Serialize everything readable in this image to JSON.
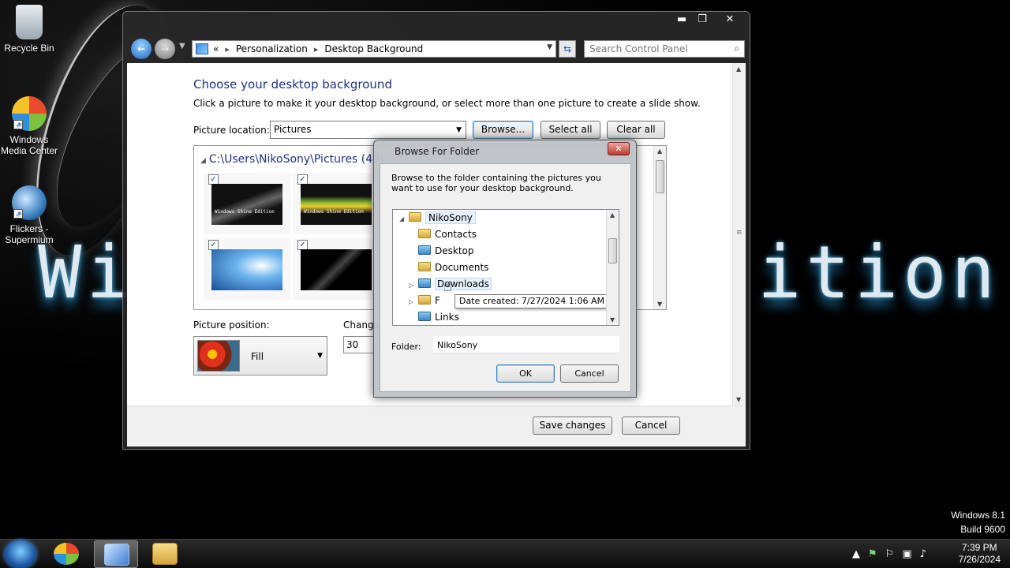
{
  "desktop": {
    "icons": [
      {
        "label": "Recycle Bin",
        "icon": "recycle-bin-icon"
      },
      {
        "label": "Windows Media Center",
        "icon": "media-center-icon"
      },
      {
        "label": "Flickers - Supermium",
        "icon": "supermium-icon"
      }
    ],
    "wallpaper_left": "Wi",
    "wallpaper_right": "ition",
    "os_name": "Windows 8.1",
    "os_build": "Build 9600"
  },
  "taskbar": {
    "items": [
      "start-orb-icon",
      "windows-media-center-taskbar-icon",
      "control-panel-taskbar-icon",
      "file-explorer-taskbar-icon"
    ],
    "tray_icons": [
      "show-hidden-icons-icon",
      "network-icon",
      "action-center-icon",
      "monitor-icon",
      "volume-icon"
    ],
    "time": "7:39 PM",
    "date": "7/26/2024"
  },
  "control_panel": {
    "caption_buttons": {
      "minimize": "▬",
      "maximize": "❐",
      "close": "✕"
    },
    "address": {
      "prefix": "«",
      "crumbs": [
        "Personalization",
        "Desktop Background"
      ]
    },
    "search_placeholder": "Search Control Panel",
    "heading": "Choose your desktop background",
    "subtext": "Click a picture to make it your desktop background, or select more than one picture to create a slide show.",
    "picture_location_label": "Picture location:",
    "picture_location_value": "Pictures",
    "browse_label": "Browse...",
    "select_all_label": "Select all",
    "clear_all_label": "Clear all",
    "pictures_path": "C:\\Users\\NikoSony\\Pictures (49)",
    "thumbnails": [
      {
        "checked": "✓",
        "caption": "Windows Shine Edition"
      },
      {
        "checked": "✓",
        "caption": "Windows Shine Edition"
      },
      {
        "checked": "✓",
        "caption": ""
      },
      {
        "checked": "✓",
        "caption": ""
      }
    ],
    "picture_position_label": "Picture position:",
    "picture_position_value": "Fill",
    "change_label": "Change",
    "interval_value": "30 min",
    "save_label": "Save changes",
    "cancel_label": "Cancel"
  },
  "browse_dialog": {
    "title": "Browse For Folder",
    "close": "✕",
    "description": "Browse to the folder containing the pictures you want to use for your desktop background.",
    "tree": [
      {
        "label": "NikoSony",
        "expander": "◢",
        "level": 0
      },
      {
        "label": "Contacts",
        "expander": "",
        "level": 1
      },
      {
        "label": "Desktop",
        "expander": "",
        "level": 1
      },
      {
        "label": "Documents",
        "expander": "",
        "level": 1
      },
      {
        "label": "Downloads",
        "expander": "▷",
        "level": 1
      },
      {
        "label": "F",
        "expander": "▷",
        "level": 1
      },
      {
        "label": "Links",
        "expander": "",
        "level": 1
      }
    ],
    "tooltip": "Date created: 7/27/2024 1:06 AM",
    "folder_label": "Folder:",
    "folder_value": "NikoSony",
    "ok_label": "OK",
    "cancel_label": "Cancel"
  }
}
